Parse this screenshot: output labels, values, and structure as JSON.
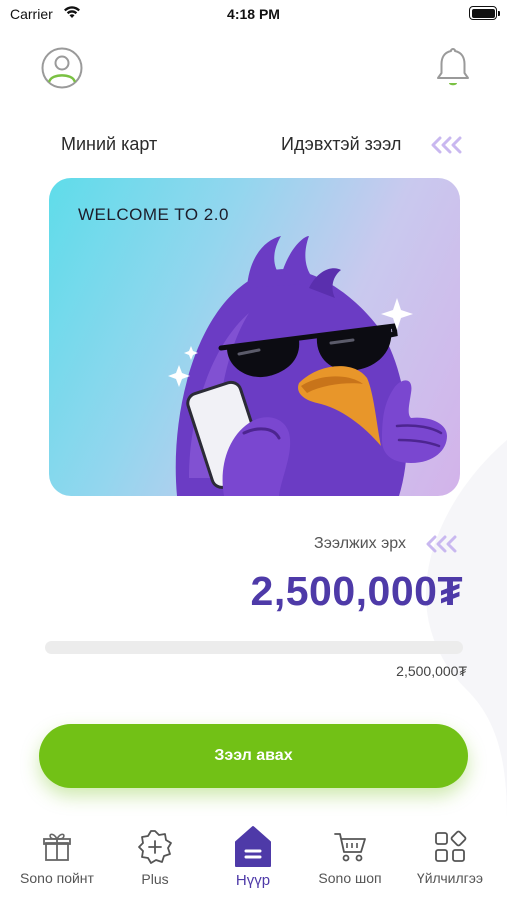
{
  "status_bar": {
    "carrier": "Carrier",
    "time": "4:18 PM"
  },
  "tabs": {
    "my_card": "Миний карт",
    "active_loan": "Идэвхтэй зээл"
  },
  "card": {
    "headline": "WELCOME TO 2.0"
  },
  "credit": {
    "label": "Зээлжих эрх",
    "amount": "2,500,000₮",
    "progress_caption": "2,500,000₮",
    "used_fraction": 0
  },
  "actions": {
    "get_loan": "Зээл авах"
  },
  "bottom_nav": [
    {
      "label": "Sono пойнт",
      "icon": "gift-icon"
    },
    {
      "label": "Plus",
      "icon": "plus-badge-icon"
    },
    {
      "label": "Нүүр",
      "icon": "home-icon"
    },
    {
      "label": "Sono шоп",
      "icon": "cart-icon"
    },
    {
      "label": "Үйлчилгээ",
      "icon": "services-grid-icon"
    }
  ],
  "colors": {
    "brand_purple": "#4e3aa8",
    "accent_green": "#72c116",
    "chevron_lilac": "#c9b8f0"
  }
}
